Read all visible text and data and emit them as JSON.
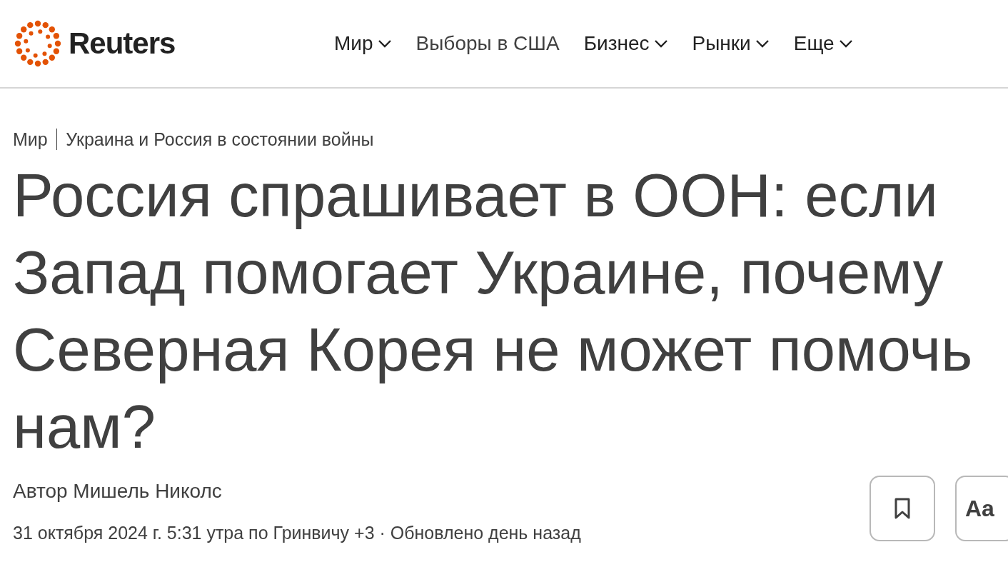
{
  "header": {
    "logo": {
      "text": "Reuters"
    },
    "nav": [
      {
        "label": "Мир",
        "has_dropdown": true
      },
      {
        "label": "Выборы в США",
        "has_dropdown": false
      },
      {
        "label": "Бизнес",
        "has_dropdown": true
      },
      {
        "label": "Рынки",
        "has_dropdown": true
      },
      {
        "label": "Еще",
        "has_dropdown": true
      }
    ]
  },
  "article": {
    "breadcrumb": [
      "Мир",
      "Украина и Россия в состоянии войны"
    ],
    "headline": "Россия спрашивает в ООН: если Запад помогает Украине, почему Северная Корея не может помочь нам?",
    "byline": "Автор Мишель Николс",
    "dateline": "31 октября 2024 г. 5:31 утра по Гринвичу +3 · Обновлено день назад",
    "tools": [
      {
        "kind": "bookmark"
      },
      {
        "kind": "text",
        "label": "Aa"
      }
    ]
  }
}
